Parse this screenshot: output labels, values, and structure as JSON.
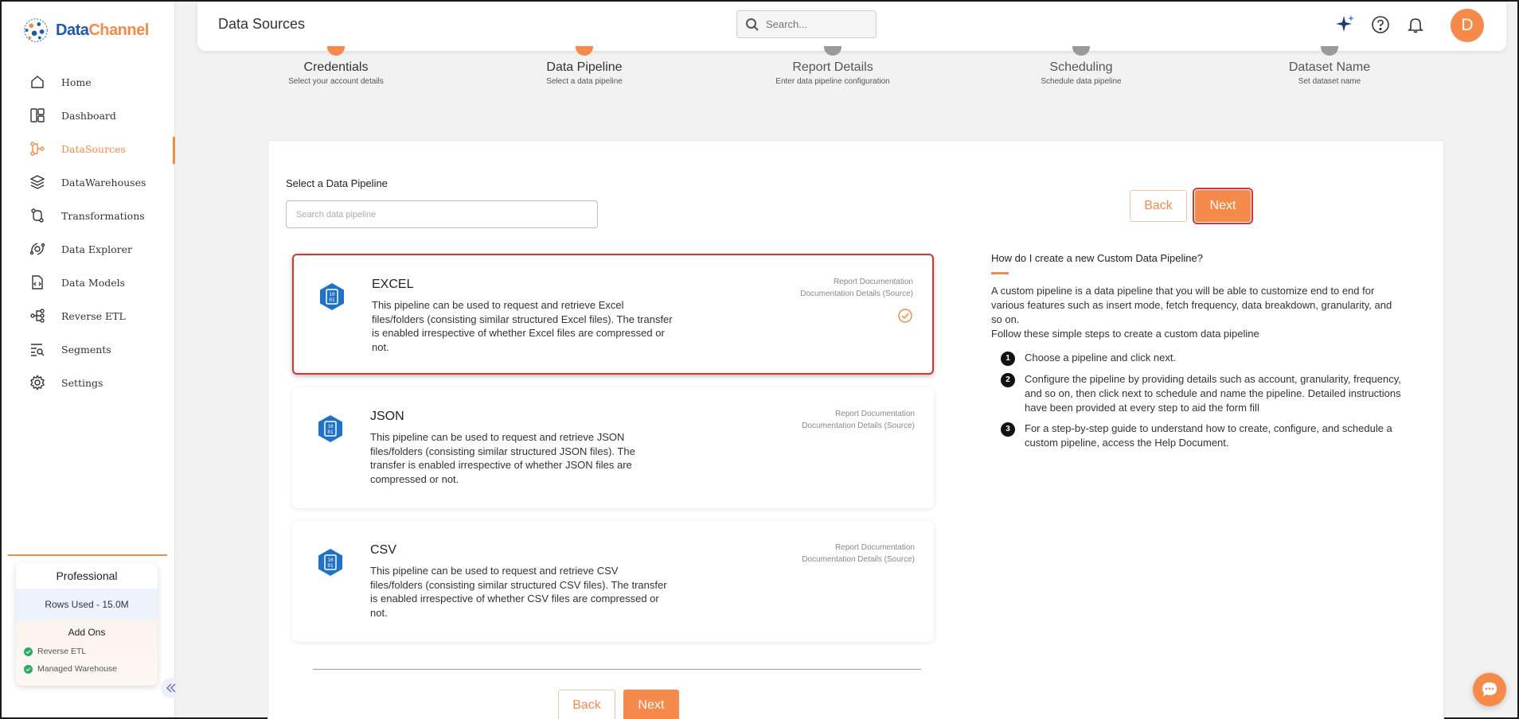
{
  "brand": {
    "name_part1": "Data",
    "name_part2": "Channel",
    "color_primary": "#1e5aa8",
    "color_accent": "#f58a4b"
  },
  "header": {
    "title": "Data Sources",
    "search_placeholder": "Search...",
    "avatar_letter": "D",
    "icons": [
      "sparkle-icon",
      "help-icon",
      "bell-icon"
    ]
  },
  "sidebar": {
    "items": [
      {
        "label": "Home",
        "icon": "home-icon",
        "active": false
      },
      {
        "label": "Dashboard",
        "icon": "dashboard-icon",
        "active": false
      },
      {
        "label": "DataSources",
        "icon": "datasources-icon",
        "active": true
      },
      {
        "label": "DataWarehouses",
        "icon": "layers-icon",
        "active": false
      },
      {
        "label": "Transformations",
        "icon": "transform-icon",
        "active": false
      },
      {
        "label": "Data Explorer",
        "icon": "explorer-icon",
        "active": false
      },
      {
        "label": "Data Models",
        "icon": "models-icon",
        "active": false
      },
      {
        "label": "Reverse ETL",
        "icon": "reverse-etl-icon",
        "active": false
      },
      {
        "label": "Segments",
        "icon": "segments-icon",
        "active": false
      },
      {
        "label": "Settings",
        "icon": "gear-icon",
        "active": false
      }
    ],
    "plan": {
      "name": "Professional",
      "rows_used": "Rows Used - 15.0M",
      "addons_title": "Add Ons",
      "addons": [
        "Reverse ETL",
        "Managed Warehouse"
      ]
    }
  },
  "stepper": {
    "steps": [
      {
        "label": "Credentials",
        "sub": "Select your account details",
        "status": "done"
      },
      {
        "label": "Data Pipeline",
        "sub": "Select a data pipeline",
        "status": "current"
      },
      {
        "label": "Report Details",
        "sub": "Enter data pipeline configuration",
        "status": "pending"
      },
      {
        "label": "Scheduling",
        "sub": "Schedule data pipeline",
        "status": "pending"
      },
      {
        "label": "Dataset Name",
        "sub": "Set dataset name",
        "status": "pending"
      }
    ]
  },
  "main": {
    "select_label": "Select a Data Pipeline",
    "search_placeholder": "Search data pipeline",
    "back_label": "Back",
    "next_label": "Next",
    "pipelines": [
      {
        "name": "EXCEL",
        "description": "This pipeline can be used to request and retrieve Excel files/folders (consisting similar structured Excel files). The transfer is enabled irrespective of whether Excel files are compressed or not.",
        "link1": "Report Documentation",
        "link2": "Documentation Details (Source)",
        "selected": true
      },
      {
        "name": "JSON",
        "description": "This pipeline can be used to request and retrieve JSON files/folders (consisting similar structured JSON files). The transfer is enabled irrespective of whether JSON files are compressed or not.",
        "link1": "Report Documentation",
        "link2": "Documentation Details (Source)",
        "selected": false
      },
      {
        "name": "CSV",
        "description": "This pipeline can be used to request and retrieve CSV files/folders (consisting similar structured CSV files). The transfer is enabled irrespective of whether CSV files are compressed or not.",
        "link1": "Report Documentation",
        "link2": "Documentation Details (Source)",
        "selected": false
      }
    ]
  },
  "help": {
    "title": "How do I create a new Custom Data Pipeline?",
    "intro1": "A custom pipeline is a data pipeline that you will be able to customize end to end for various features such as insert mode, fetch frequency, data breakdown, granularity, and so on.",
    "intro2": "Follow these simple steps to create a custom data pipeline",
    "steps": [
      "Choose a pipeline and click next.",
      "Configure the pipeline by providing details such as account, granularity, frequency, and so on, then click next to schedule and name the pipeline. Detailed instructions have been provided at every step to aid the form fill",
      "For a step-by-step guide to understand how to create, configure, and schedule a custom pipeline, access the Help Document."
    ]
  }
}
